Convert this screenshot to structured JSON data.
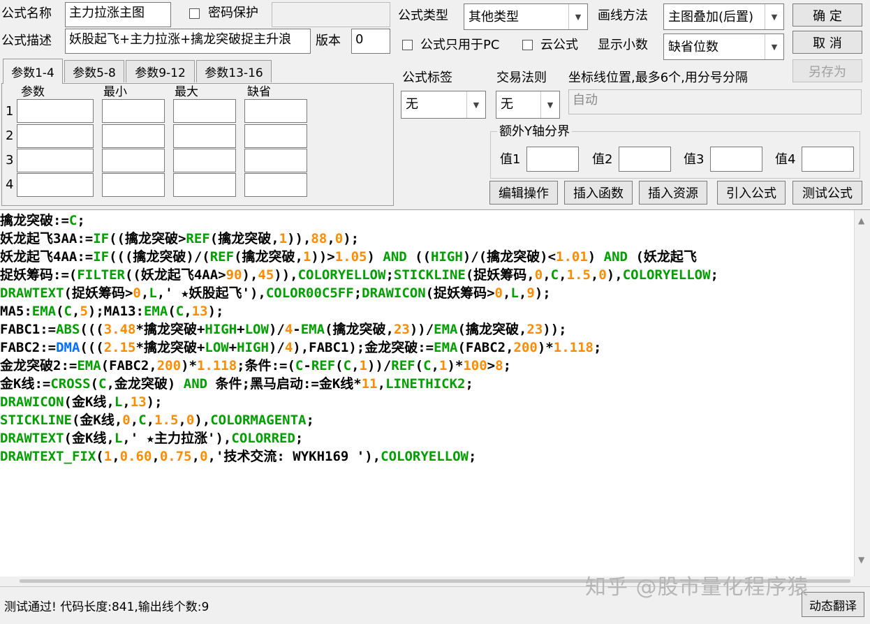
{
  "form": {
    "name_label": "公式名称",
    "name_value": "主力拉涨主图",
    "password_label": "密码保护",
    "desc_label": "公式描述",
    "desc_value": "妖股起飞+主力拉涨+擒龙突破捉主升浪",
    "version_label": "版本",
    "version_value": "0",
    "type_label": "公式类型",
    "type_value": "其他类型",
    "draw_method_label": "画线方法",
    "draw_method_value": "主图叠加(后置)",
    "pc_only_label": "公式只用于PC",
    "cloud_label": "云公式",
    "decimal_label": "显示小数",
    "decimal_value": "缺省位数",
    "tag_label": "公式标签",
    "tag_value": "无",
    "trade_rule_label": "交易法则",
    "trade_rule_value": "无",
    "axis_label": "坐标线位置,最多6个,用分号分隔",
    "axis_placeholder": "自动",
    "extra_y_label": "额外Y轴分界",
    "val1_label": "值1",
    "val2_label": "值2",
    "val3_label": "值3",
    "val4_label": "值4"
  },
  "buttons": {
    "ok": "确 定",
    "cancel": "取 消",
    "save_as": "另存为",
    "edit_ops": "编辑操作",
    "insert_func": "插入函数",
    "insert_res": "插入资源",
    "import_formula": "引入公式",
    "test_formula": "测试公式",
    "dynamic_translate": "动态翻译"
  },
  "tabs": [
    {
      "label": "参数1-4",
      "active": true
    },
    {
      "label": "参数5-8",
      "active": false
    },
    {
      "label": "参数9-12",
      "active": false
    },
    {
      "label": "参数13-16",
      "active": false
    }
  ],
  "param_table": {
    "headers": [
      "参数",
      "最小",
      "最大",
      "缺省"
    ],
    "rows": [
      "1",
      "2",
      "3",
      "4"
    ]
  },
  "code_lines": [
    [
      [
        "擒龙突破:=",
        "k"
      ],
      [
        "C",
        "g"
      ],
      [
        ";",
        "k"
      ]
    ],
    [
      [
        "妖龙起飞3AA:=",
        "k"
      ],
      [
        "IF",
        "g"
      ],
      [
        "((擒龙突破>",
        "k"
      ],
      [
        "REF",
        "g"
      ],
      [
        "(擒龙突破,",
        "k"
      ],
      [
        "1",
        "o"
      ],
      [
        ")),",
        "k"
      ],
      [
        "88",
        "o"
      ],
      [
        ",",
        "k"
      ],
      [
        "0",
        "o"
      ],
      [
        ");",
        "k"
      ]
    ],
    [
      [
        "妖龙起飞4AA:=",
        "k"
      ],
      [
        "IF",
        "g"
      ],
      [
        "(((擒龙突破)/(",
        "k"
      ],
      [
        "REF",
        "g"
      ],
      [
        "(擒龙突破,",
        "k"
      ],
      [
        "1",
        "o"
      ],
      [
        "))>",
        "k"
      ],
      [
        "1.05",
        "o"
      ],
      [
        ") ",
        "k"
      ],
      [
        "AND",
        "g"
      ],
      [
        " ((",
        "k"
      ],
      [
        "HIGH",
        "g"
      ],
      [
        ")/(擒龙突破)<",
        "k"
      ],
      [
        "1.01",
        "o"
      ],
      [
        ") ",
        "k"
      ],
      [
        "AND",
        "g"
      ],
      [
        " (妖龙起飞",
        "k"
      ]
    ],
    [
      [
        "捉妖筹码:=(",
        "k"
      ],
      [
        "FILTER",
        "g"
      ],
      [
        "((妖龙起飞4AA>",
        "k"
      ],
      [
        "90",
        "o"
      ],
      [
        "),",
        "k"
      ],
      [
        "45",
        "o"
      ],
      [
        ")),",
        "k"
      ],
      [
        "COLORYELLOW",
        "g"
      ],
      [
        ";",
        "k"
      ],
      [
        "STICKLINE",
        "g"
      ],
      [
        "(捉妖筹码,",
        "k"
      ],
      [
        "0",
        "o"
      ],
      [
        ",",
        "k"
      ],
      [
        "C",
        "g"
      ],
      [
        ",",
        "k"
      ],
      [
        "1.5",
        "o"
      ],
      [
        ",",
        "k"
      ],
      [
        "0",
        "o"
      ],
      [
        "),",
        "k"
      ],
      [
        "COLORYELLOW",
        "g"
      ],
      [
        ";",
        "k"
      ]
    ],
    [
      [
        "DRAWTEXT",
        "g"
      ],
      [
        "(捉妖筹码>",
        "k"
      ],
      [
        "0",
        "o"
      ],
      [
        ",",
        "k"
      ],
      [
        "L",
        "g"
      ],
      [
        ",' ★妖股起飞'),",
        "k"
      ],
      [
        "COLOR00C5FF",
        "g"
      ],
      [
        ";",
        "k"
      ],
      [
        "DRAWICON",
        "g"
      ],
      [
        "(捉妖筹码>",
        "k"
      ],
      [
        "0",
        "o"
      ],
      [
        ",",
        "k"
      ],
      [
        "L",
        "g"
      ],
      [
        ",",
        "k"
      ],
      [
        "9",
        "o"
      ],
      [
        ");",
        "k"
      ]
    ],
    [
      [
        "MA5:",
        "k"
      ],
      [
        "EMA",
        "g"
      ],
      [
        "(",
        "k"
      ],
      [
        "C",
        "g"
      ],
      [
        ",",
        "k"
      ],
      [
        "5",
        "o"
      ],
      [
        ");MA13:",
        "k"
      ],
      [
        "EMA",
        "g"
      ],
      [
        "(",
        "k"
      ],
      [
        "C",
        "g"
      ],
      [
        ",",
        "k"
      ],
      [
        "13",
        "o"
      ],
      [
        ");",
        "k"
      ]
    ],
    [
      [
        "FABC1:=",
        "k"
      ],
      [
        "ABS",
        "g"
      ],
      [
        "(((",
        "k"
      ],
      [
        "3.48",
        "o"
      ],
      [
        "*擒龙突破+",
        "k"
      ],
      [
        "HIGH",
        "g"
      ],
      [
        "+",
        "k"
      ],
      [
        "LOW",
        "g"
      ],
      [
        ")/",
        "k"
      ],
      [
        "4",
        "o"
      ],
      [
        "-",
        "k"
      ],
      [
        "EMA",
        "g"
      ],
      [
        "(擒龙突破,",
        "k"
      ],
      [
        "23",
        "o"
      ],
      [
        "))/",
        "k"
      ],
      [
        "EMA",
        "g"
      ],
      [
        "(擒龙突破,",
        "k"
      ],
      [
        "23",
        "o"
      ],
      [
        "));",
        "k"
      ]
    ],
    [
      [
        "FABC2:=",
        "k"
      ],
      [
        "DMA",
        "b"
      ],
      [
        "(((",
        "k"
      ],
      [
        "2.15",
        "o"
      ],
      [
        "*擒龙突破+",
        "k"
      ],
      [
        "LOW",
        "g"
      ],
      [
        "+",
        "k"
      ],
      [
        "HIGH",
        "g"
      ],
      [
        ")/",
        "k"
      ],
      [
        "4",
        "o"
      ],
      [
        "),FABC1);金龙突破:=",
        "k"
      ],
      [
        "EMA",
        "g"
      ],
      [
        "(FABC2,",
        "k"
      ],
      [
        "200",
        "o"
      ],
      [
        ")*",
        "k"
      ],
      [
        "1.118",
        "o"
      ],
      [
        ";",
        "k"
      ]
    ],
    [
      [
        "金龙突破2:=",
        "k"
      ],
      [
        "EMA",
        "g"
      ],
      [
        "(FABC2,",
        "k"
      ],
      [
        "200",
        "o"
      ],
      [
        ")*",
        "k"
      ],
      [
        "1.118",
        "o"
      ],
      [
        ";条件:=(",
        "k"
      ],
      [
        "C",
        "g"
      ],
      [
        "-",
        "k"
      ],
      [
        "REF",
        "g"
      ],
      [
        "(",
        "k"
      ],
      [
        "C",
        "g"
      ],
      [
        ",",
        "k"
      ],
      [
        "1",
        "o"
      ],
      [
        "))/",
        "k"
      ],
      [
        "REF",
        "g"
      ],
      [
        "(",
        "k"
      ],
      [
        "C",
        "g"
      ],
      [
        ",",
        "k"
      ],
      [
        "1",
        "o"
      ],
      [
        ")*",
        "k"
      ],
      [
        "100",
        "o"
      ],
      [
        ">",
        "k"
      ],
      [
        "8",
        "o"
      ],
      [
        ";",
        "k"
      ]
    ],
    [
      [
        "金K线:=",
        "k"
      ],
      [
        "CROSS",
        "g"
      ],
      [
        "(",
        "k"
      ],
      [
        "C",
        "g"
      ],
      [
        ",金龙突破) ",
        "k"
      ],
      [
        "AND",
        "g"
      ],
      [
        " 条件;黑马启动:=金K线*",
        "k"
      ],
      [
        "11",
        "o"
      ],
      [
        ",",
        "k"
      ],
      [
        "LINETHICK2",
        "g"
      ],
      [
        ";",
        "k"
      ]
    ],
    [
      [
        "DRAWICON",
        "g"
      ],
      [
        "(金K线,",
        "k"
      ],
      [
        "L",
        "g"
      ],
      [
        ",",
        "k"
      ],
      [
        "13",
        "o"
      ],
      [
        ");",
        "k"
      ]
    ],
    [
      [
        "STICKLINE",
        "g"
      ],
      [
        "(金K线,",
        "k"
      ],
      [
        "0",
        "o"
      ],
      [
        ",",
        "k"
      ],
      [
        "C",
        "g"
      ],
      [
        ",",
        "k"
      ],
      [
        "1.5",
        "o"
      ],
      [
        ",",
        "k"
      ],
      [
        "0",
        "o"
      ],
      [
        "),",
        "k"
      ],
      [
        "COLORMAGENTA",
        "g"
      ],
      [
        ";",
        "k"
      ]
    ],
    [
      [
        "DRAWTEXT",
        "g"
      ],
      [
        "(金K线,",
        "k"
      ],
      [
        "L",
        "g"
      ],
      [
        ",' ★主力拉涨'),",
        "k"
      ],
      [
        "COLORRED",
        "g"
      ],
      [
        ";",
        "k"
      ]
    ],
    [
      [
        "DRAWTEXT_FIX",
        "g"
      ],
      [
        "(",
        "k"
      ],
      [
        "1",
        "o"
      ],
      [
        ",",
        "k"
      ],
      [
        "0.60",
        "o"
      ],
      [
        ",",
        "k"
      ],
      [
        "0.75",
        "o"
      ],
      [
        ",",
        "k"
      ],
      [
        "0",
        "o"
      ],
      [
        ",'技术交流: WYKH169 '),",
        "k"
      ],
      [
        "COLORYELLOW",
        "g"
      ],
      [
        ";",
        "k"
      ]
    ]
  ],
  "status": {
    "text": "测试通过! 代码长度:841,输出线个数:9"
  },
  "watermark": "知乎 @股市量化程序猿",
  "colors": {
    "keyword": "#00a000",
    "number": "#ff8c00",
    "text": "#000000",
    "dma": "#0070ff"
  },
  "icons": {
    "dropdown": "chevron-down-icon",
    "scroll_up": "triangle-up-icon",
    "scroll_down": "triangle-down-icon"
  }
}
